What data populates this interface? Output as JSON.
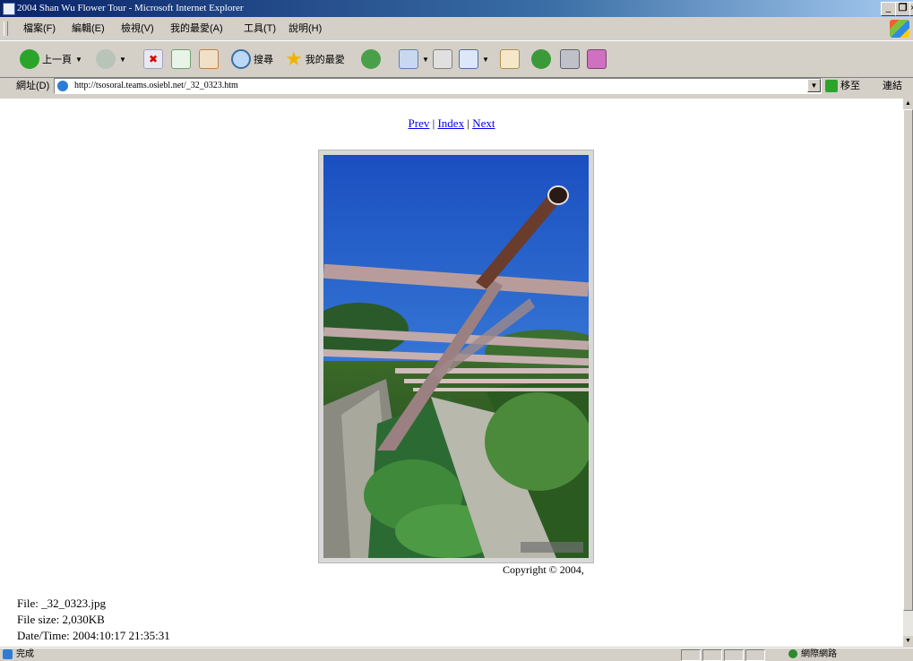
{
  "window": {
    "title": "2004 Shan Wu Flower Tour - Microsoft Internet Explorer",
    "controls": [
      "_",
      "❐",
      "×"
    ]
  },
  "menu": [
    "檔案(F)",
    "編輯(E)",
    "檢視(V)",
    "我的最愛(A)",
    "工具(T)",
    "說明(H)"
  ],
  "toolbar": {
    "back_label": "上一頁",
    "search_label": "搜尋",
    "favorites_label": "我的最愛"
  },
  "address": {
    "label": "網址(D)",
    "url": "http://tsosoral.teams.osiebl.net/_32_0323.htm",
    "go_label": "移至",
    "links_label": "連結"
  },
  "page": {
    "nav": {
      "prev": "Prev",
      "sep1": " | ",
      "index": "Index",
      "sep2": " | ",
      "next": "Next"
    },
    "copyright": "Copyright © 2004,",
    "file": "File: _32_0323.jpg",
    "file_size": "File size: 2,030KB",
    "datetime": "Date/Time: 2004:10:17 21:35:31"
  },
  "status": {
    "text": "完成",
    "zone": "網際網路"
  },
  "colors": {
    "sky": "#2a6fd6",
    "link": "#0000ee",
    "chrome": "#d4d0c8"
  }
}
